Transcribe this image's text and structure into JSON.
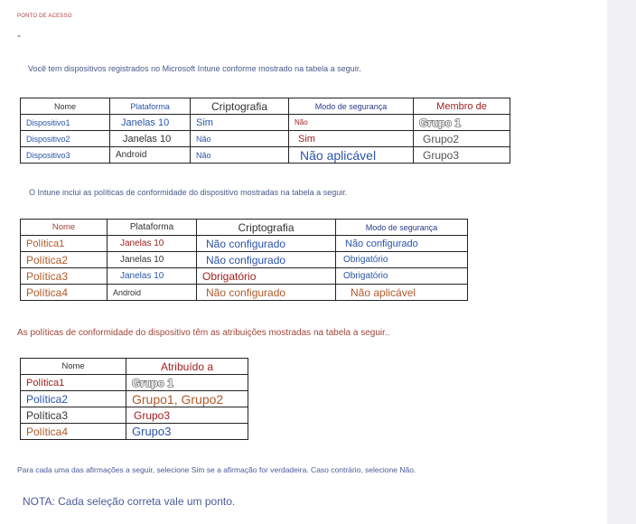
{
  "header": {
    "hotspot_label": "PONTO DE ACESSO",
    "dash": "-"
  },
  "intro": {
    "devices_text": "Você tem dispositivos registrados no Microsoft Intune conforme mostrado na tabela a seguir.",
    "policies_text": "O Intune inclui as políticas de conformidade do dispositivo mostradas na tabela a seguir.",
    "assignments_text": "As políticas de conformidade do dispositivo têm as atribuições mostradas na tabela a seguir..",
    "instruction_text": "Para cada uma das afirmações a seguir, selecione Sim se a afirmação for verdadeira. Caso contrário, selecione Não.",
    "note_text": "NOTA: Cada seleção correta vale um ponto."
  },
  "devices_table": {
    "headers": [
      "Nome",
      "Plataforma",
      "Criptografia",
      "Modo de segurança",
      "Membro de"
    ],
    "rows": [
      [
        "Dispositivo1",
        "Janelas 10",
        "Sim",
        "Não",
        "Grupo 1"
      ],
      [
        "Dispositivo2",
        "Janelas 10",
        "Não",
        "Sim",
        "Grupo2"
      ],
      [
        "Dispositivo3",
        "Android",
        "Não",
        "Não aplicável",
        "Grupo3"
      ]
    ]
  },
  "policies_table": {
    "headers": [
      "Nome",
      "Plataforma",
      "Criptografia",
      "Modo de segurança"
    ],
    "rows": [
      [
        "Política1",
        "Janelas 10",
        "Não configurado",
        "Não configurado"
      ],
      [
        "Política2",
        "Janelas 10",
        "Não configurado",
        "Obrigatório"
      ],
      [
        "Política3",
        "Janelas 10",
        "Obrigatório",
        "Obrigatório"
      ],
      [
        "Política4",
        "Android",
        "Não configurado",
        "Não aplicável"
      ]
    ]
  },
  "assignments_table": {
    "headers": [
      "Nome",
      "Atribuído a"
    ],
    "rows": [
      [
        "Política1",
        "Grupo 1"
      ],
      [
        "Política2",
        "Grupo1, Grupo2"
      ],
      [
        "Política3",
        "Grupo3"
      ],
      [
        "Política4",
        "Grupo3"
      ]
    ]
  }
}
